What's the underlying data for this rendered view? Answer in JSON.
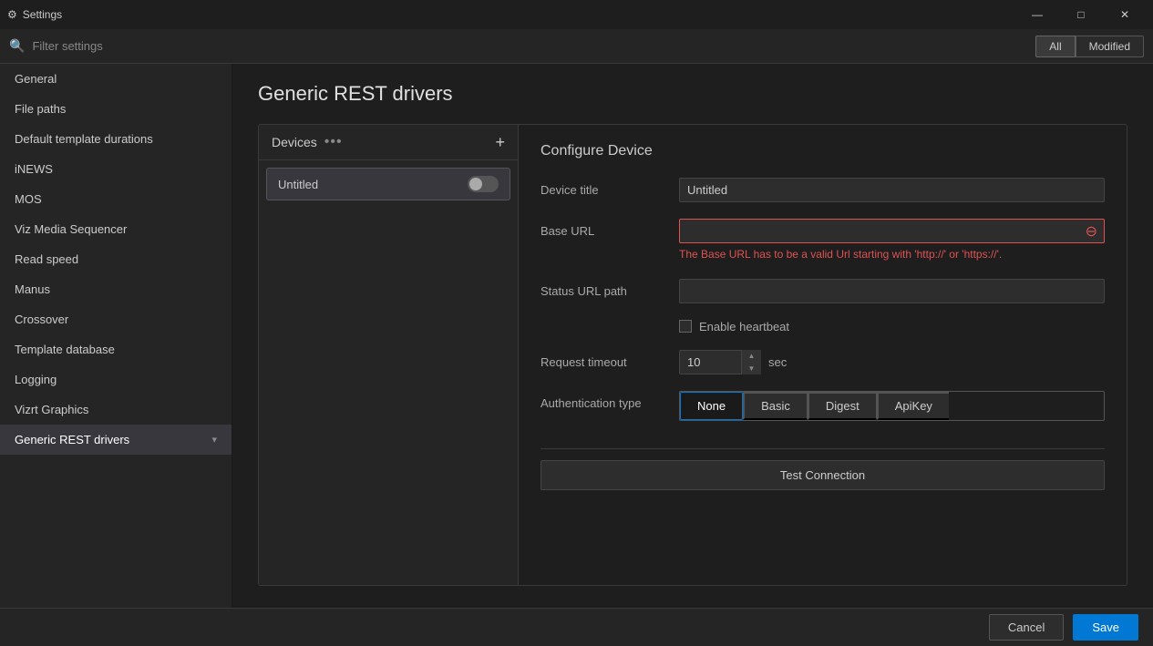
{
  "titlebar": {
    "title": "Settings",
    "icon": "⚙",
    "minimize": "—",
    "maximize": "□",
    "close": "✕"
  },
  "searchbar": {
    "placeholder": "Filter settings",
    "filter_all": "All",
    "filter_modified": "Modified"
  },
  "sidebar": {
    "items": [
      {
        "label": "General",
        "active": false
      },
      {
        "label": "File paths",
        "active": false
      },
      {
        "label": "Default template durations",
        "active": false
      },
      {
        "label": "iNEWS",
        "active": false
      },
      {
        "label": "MOS",
        "active": false
      },
      {
        "label": "Viz Media Sequencer",
        "active": false
      },
      {
        "label": "Read speed",
        "active": false
      },
      {
        "label": "Manus",
        "active": false
      },
      {
        "label": "Crossover",
        "active": false
      },
      {
        "label": "Template database",
        "active": false
      },
      {
        "label": "Logging",
        "active": false
      },
      {
        "label": "Vizrt Graphics",
        "active": false
      },
      {
        "label": "Generic REST drivers",
        "active": true
      }
    ]
  },
  "page": {
    "title": "Generic REST drivers",
    "devices_panel": {
      "title": "Devices",
      "dots": "•••",
      "add": "+",
      "device": {
        "name": "Untitled",
        "toggle": false
      }
    },
    "config_panel": {
      "title": "Configure Device",
      "fields": {
        "device_title_label": "Device title",
        "device_title_value": "Untitled",
        "base_url_label": "Base URL",
        "base_url_value": "",
        "base_url_error": "The Base URL has to be a valid Url starting with 'http://' or 'https://'.",
        "status_url_label": "Status URL path",
        "status_url_value": "",
        "heartbeat_label": "Enable heartbeat",
        "timeout_label": "Request timeout",
        "timeout_value": "10",
        "timeout_unit": "sec",
        "auth_label": "Authentication type",
        "auth_options": [
          "None",
          "Basic",
          "Digest",
          "ApiKey"
        ],
        "auth_active": "None"
      },
      "test_btn": "Test Connection"
    }
  },
  "footer": {
    "cancel": "Cancel",
    "save": "Save"
  }
}
